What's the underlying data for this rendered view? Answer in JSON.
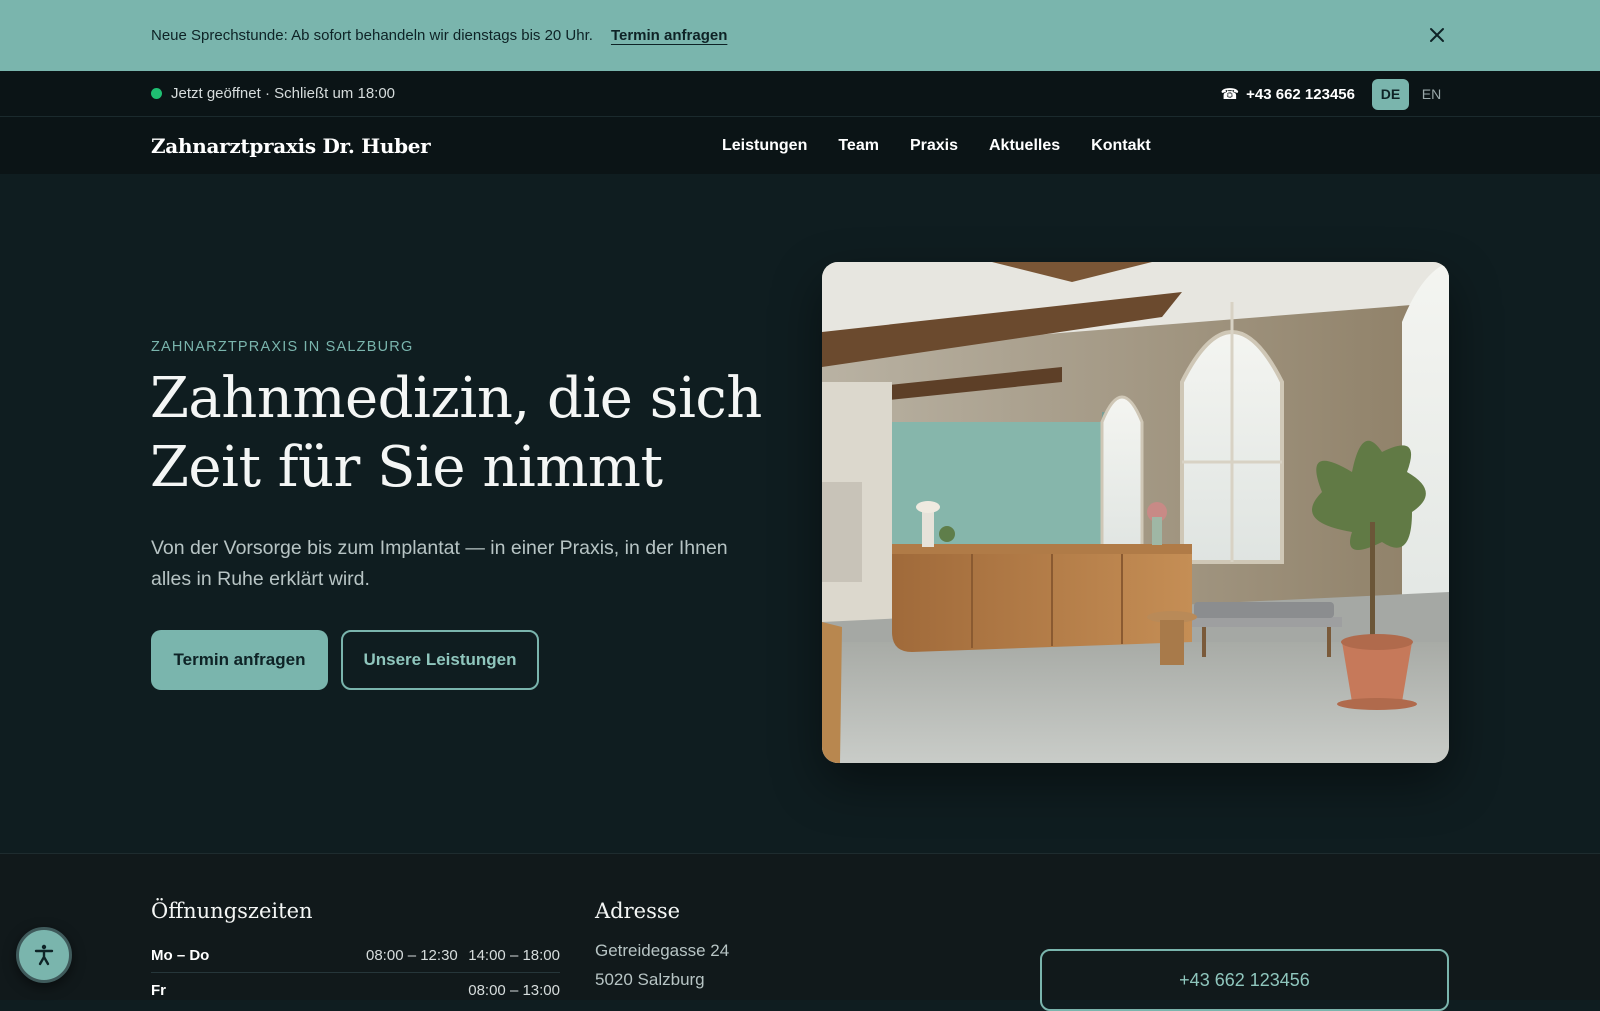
{
  "announcement": {
    "message": "Neue Sprechstunde: Ab sofort behandeln wir dienstags bis 20 Uhr.",
    "cta": "Termin anfragen",
    "close_icon": "close-icon"
  },
  "topbar": {
    "status": "Jetzt geöffnet · Schließt um 18:00",
    "status_color": "#1fbf72",
    "phone_icon": "☎",
    "phone": "+43 662 123456",
    "languages": [
      "DE",
      "EN"
    ],
    "active_language": "DE"
  },
  "header": {
    "logo": "Zahnarztpraxis Dr. Huber",
    "nav": [
      "Leistungen",
      "Team",
      "Praxis",
      "Aktuelles",
      "Kontakt"
    ]
  },
  "hero": {
    "eyebrow": "ZAHNARZTPRAXIS IN SALZBURG",
    "headline": "Zahnmedizin, die sich Zeit für Sie nimmt",
    "lead": "Von der Vorsorge bis zum Implantat — in einer Praxis, in der Ihnen alles in Ruhe erklärt wird.",
    "primary_cta": "Termin anfragen",
    "secondary_cta": "Unsere Leistungen",
    "image_alt": "reception-photo"
  },
  "info": {
    "hours_title": "Öffnungszeiten",
    "hours": [
      {
        "day": "Mo – Do",
        "morning": "08:00 – 12:30",
        "afternoon": "14:00 – 18:00"
      },
      {
        "day": "Fr",
        "morning": "",
        "afternoon": "08:00 – 13:00"
      }
    ],
    "address_title": "Adresse",
    "address_lines": [
      "Getreidegasse 24",
      "5020 Salzburg"
    ],
    "phone_button": "+43 662 123456"
  },
  "colors": {
    "accent": "#7ab5ad",
    "background": "#0f1d20",
    "bar": "#0b1416"
  }
}
